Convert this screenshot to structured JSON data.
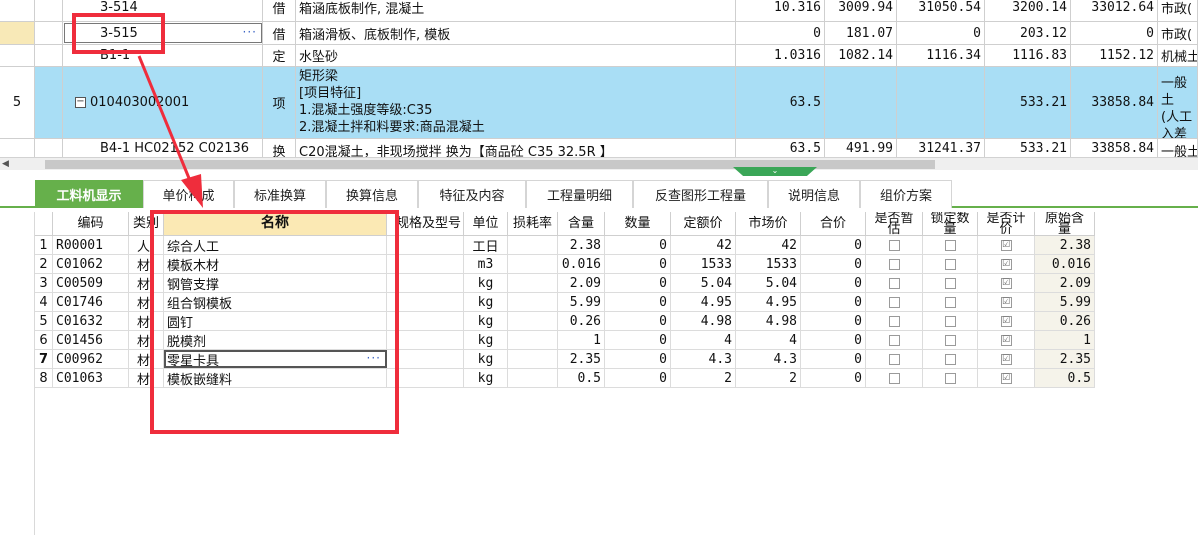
{
  "upper_rows": [
    {
      "rownum": "",
      "code": "3-514",
      "type": "借",
      "name": "箱涵底板制作, 混凝土",
      "qty": "10.316",
      "v1": "3009.94",
      "v2": "31050.54",
      "v3": "3200.14",
      "v4": "33012.64",
      "extra": "市政("
    },
    {
      "rownum": "",
      "code": "3-515",
      "type": "借",
      "name": "箱涵滑板、底板制作, 模板",
      "qty": "0",
      "v1": "181.07",
      "v2": "0",
      "v3": "203.12",
      "v4": "0",
      "extra": "市政(",
      "ellipsis": "···"
    },
    {
      "rownum": "",
      "code": "B1-1",
      "type": "定",
      "name": "水坠砂",
      "qty": "1.0316",
      "v1": "1082.14",
      "v2": "1116.34",
      "v3": "1116.83",
      "v4": "1152.12",
      "extra": "机械土"
    },
    {
      "rownum": "5",
      "expander": "−",
      "code": "010403002001",
      "type": "项",
      "name_lines": [
        "矩形梁",
        "[项目特征]",
        "1.混凝土强度等级:C35",
        "2.混凝土拌和料要求:商品混凝土"
      ],
      "qty": "63.5",
      "v1": "",
      "v2": "",
      "v3": "533.21",
      "v4": "33858.84",
      "extra_lines": [
        "一般土",
        "(人工",
        "入差价"
      ]
    },
    {
      "rownum": "",
      "code": "B4-1 HC02152 C02136",
      "type": "换",
      "name": "C20混凝土，非现场搅拌    换为【商品砼 C35 32.5R 】",
      "qty": "63.5",
      "v1": "491.99",
      "v2": "31241.37",
      "v3": "533.21",
      "v4": "33858.84",
      "extra": "一般土"
    }
  ],
  "splitter_glyph": "⌄",
  "scroll_left_glyph": "◀",
  "tabs": [
    {
      "label": "工料机显示",
      "active": true
    },
    {
      "label": "单价构成"
    },
    {
      "label": "标准换算"
    },
    {
      "label": "换算信息"
    },
    {
      "label": "特征及内容"
    },
    {
      "label": "工程量明细"
    },
    {
      "label": "反查图形工程量"
    },
    {
      "label": "说明信息"
    },
    {
      "label": "组价方案"
    }
  ],
  "lower_headers": {
    "code": "编码",
    "category": "类别",
    "name": "名称",
    "spec": "规格及型号",
    "unit": "单位",
    "loss": "损耗率",
    "content": "含量",
    "amount": "数量",
    "fixed_price": "定额价",
    "market_price": "市场价",
    "total": "合价",
    "provisional": "是否暂估",
    "locked": "锁定数量",
    "priced": "是否计价",
    "orig_content": "原始含量"
  },
  "lower_rows": [
    {
      "n": "1",
      "code": "R00001",
      "cat": "人",
      "name": "综合人工",
      "spec": "",
      "unit": "工日",
      "loss": "",
      "content": "2.38",
      "amount": "0",
      "fixed": "42",
      "market": "42",
      "total": "0",
      "priced": "☑",
      "orig": "2.38"
    },
    {
      "n": "2",
      "code": "C01062",
      "cat": "材",
      "name": "模板木材",
      "spec": "",
      "unit": "m3",
      "loss": "",
      "content": "0.016",
      "amount": "0",
      "fixed": "1533",
      "market": "1533",
      "total": "0",
      "priced": "☑",
      "orig": "0.016"
    },
    {
      "n": "3",
      "code": "C00509",
      "cat": "材",
      "name": "钢管支撑",
      "spec": "",
      "unit": "kg",
      "loss": "",
      "content": "2.09",
      "amount": "0",
      "fixed": "5.04",
      "market": "5.04",
      "total": "0",
      "priced": "☑",
      "orig": "2.09"
    },
    {
      "n": "4",
      "code": "C01746",
      "cat": "材",
      "name": "组合钢模板",
      "spec": "",
      "unit": "kg",
      "loss": "",
      "content": "5.99",
      "amount": "0",
      "fixed": "4.95",
      "market": "4.95",
      "total": "0",
      "priced": "☑",
      "orig": "5.99"
    },
    {
      "n": "5",
      "code": "C01632",
      "cat": "材",
      "name": "圆钉",
      "spec": "",
      "unit": "kg",
      "loss": "",
      "content": "0.26",
      "amount": "0",
      "fixed": "4.98",
      "market": "4.98",
      "total": "0",
      "priced": "☑",
      "orig": "0.26"
    },
    {
      "n": "6",
      "code": "C01456",
      "cat": "材",
      "name": "脱模剂",
      "spec": "",
      "unit": "kg",
      "loss": "",
      "content": "1",
      "amount": "0",
      "fixed": "4",
      "market": "4",
      "total": "0",
      "priced": "☑",
      "orig": "1"
    },
    {
      "n": "7",
      "code": "C00962",
      "cat": "材",
      "name": "零星卡具",
      "spec": "",
      "unit": "kg",
      "loss": "",
      "content": "2.35",
      "amount": "0",
      "fixed": "4.3",
      "market": "4.3",
      "total": "0",
      "priced": "☑",
      "orig": "2.35",
      "selected": true,
      "ellipsis": "···"
    },
    {
      "n": "8",
      "code": "C01063",
      "cat": "材",
      "name": "模板嵌缝料",
      "spec": "",
      "unit": "kg",
      "loss": "",
      "content": "0.5",
      "amount": "0",
      "fixed": "2",
      "market": "2",
      "total": "0",
      "priced": "☑",
      "orig": "0.5"
    }
  ],
  "colors": {
    "accent": "#66b04b",
    "selection": "#a9def5",
    "annotation": "#ef2d3c"
  }
}
